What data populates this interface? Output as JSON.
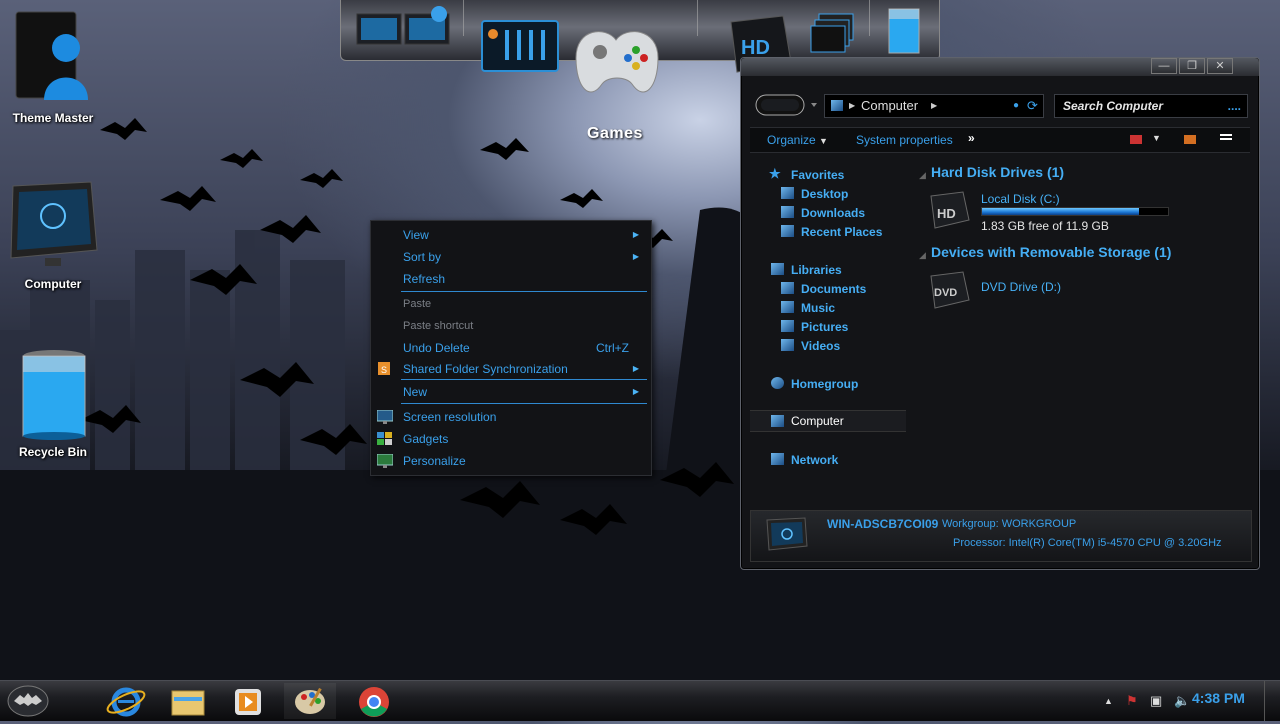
{
  "desktop": {
    "icons": [
      {
        "label": "Theme Master"
      },
      {
        "label": "Computer"
      },
      {
        "label": "Recycle Bin"
      }
    ],
    "games_label": "Games"
  },
  "context_menu": {
    "items": [
      {
        "label": "View",
        "submenu": true
      },
      {
        "label": "Sort by",
        "submenu": true
      },
      {
        "label": "Refresh"
      },
      {
        "label": "Paste",
        "disabled": true
      },
      {
        "label": "Paste shortcut",
        "disabled": true
      },
      {
        "label": "Undo Delete",
        "shortcut": "Ctrl+Z"
      },
      {
        "label": "Shared Folder Synchronization",
        "submenu": true
      },
      {
        "label": "New",
        "submenu": true
      },
      {
        "label": "Screen resolution"
      },
      {
        "label": "Gadgets"
      },
      {
        "label": "Personalize"
      }
    ]
  },
  "explorer": {
    "breadcrumb": "Computer",
    "search_placeholder": "Search Computer",
    "search_dots": "....",
    "toolbar": {
      "organize": "Organize",
      "system_properties": "System properties",
      "more": "»"
    },
    "nav": {
      "favorites": "Favorites",
      "desktop": "Desktop",
      "downloads": "Downloads",
      "recent_places": "Recent Places",
      "libraries": "Libraries",
      "documents": "Documents",
      "music": "Music",
      "pictures": "Pictures",
      "videos": "Videos",
      "homegroup": "Homegroup",
      "computer": "Computer",
      "network": "Network"
    },
    "groups": {
      "hdd_title": "Hard Disk Drives (1)",
      "removable_title": "Devices with Removable Storage (1)"
    },
    "drives": {
      "c_name": "Local Disk (C:)",
      "c_free": "1.83 GB free of 11.9 GB",
      "c_used_fraction": 0.846,
      "d_name": "DVD Drive (D:)"
    },
    "details": {
      "computer_name": "WIN-ADSCB7COI09",
      "workgroup": "Workgroup: WORKGROUP",
      "processor": "Processor: Intel(R) Core(TM) i5-4570 CPU @ 3.20GHz"
    }
  },
  "taskbar": {
    "clock": "4:38 PM"
  },
  "colors": {
    "accent": "#3aa0ea",
    "menu_bg": "#121316"
  }
}
